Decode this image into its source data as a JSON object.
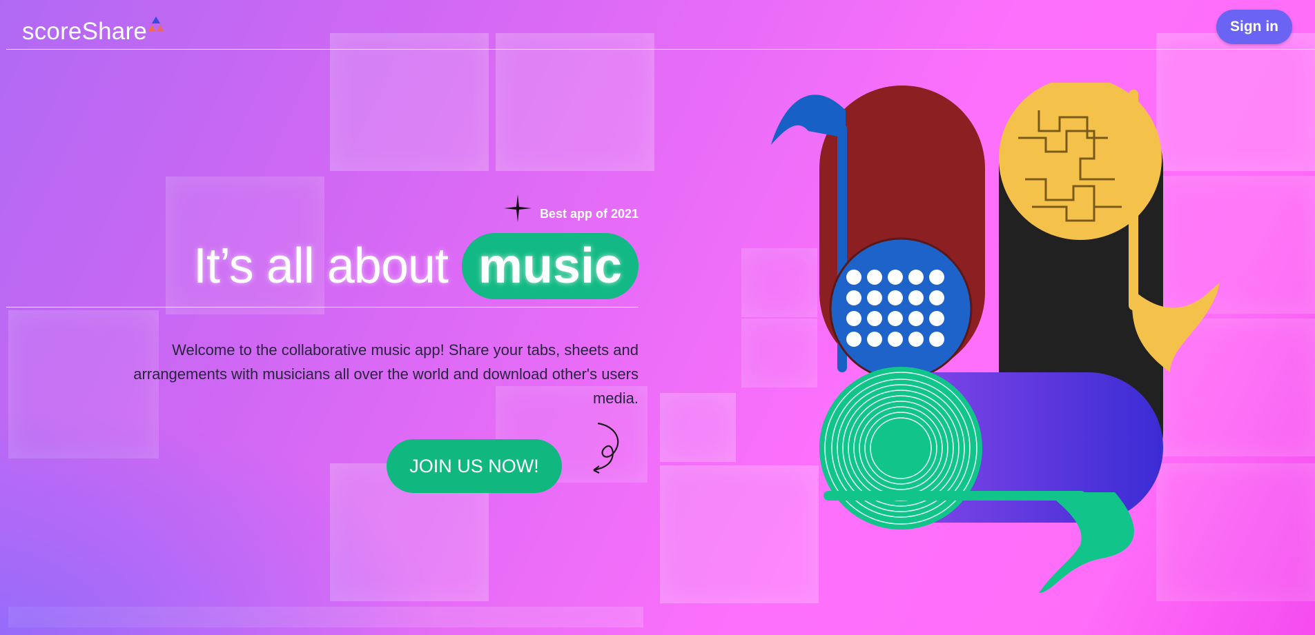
{
  "app": {
    "logo_text": "scoreShare"
  },
  "header": {
    "sign_in_label": "Sign in"
  },
  "hero": {
    "badge": "Best app of 2021",
    "headline_prefix": "It’s all about",
    "headline_highlight": "music",
    "intro": "Welcome to the collaborative music app! Share your tabs, sheets and arrangements with musicians all over the world and download other's users media.",
    "cta_label": "JOIN US NOW!"
  },
  "colors": {
    "accent_green": "#12b984",
    "sign_in_purple": "#6b63f3",
    "background_pink": "#ff6df8",
    "background_purple": "#b169f4"
  },
  "icons": [
    "logo-triangles-icon",
    "sparkle-star-icon",
    "curly-arrow-icon"
  ]
}
